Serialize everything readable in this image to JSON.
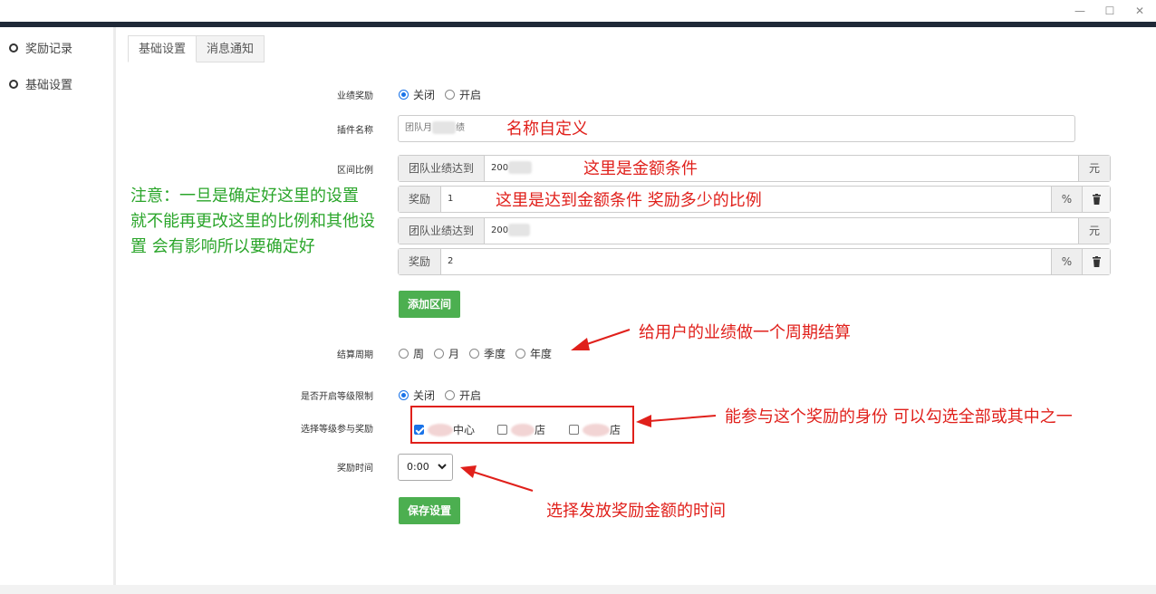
{
  "window": {
    "controls": [
      "—",
      "☐",
      "✕"
    ]
  },
  "sidebar": {
    "items": [
      {
        "label": "奖励记录"
      },
      {
        "label": "基础设置"
      }
    ]
  },
  "tabs": [
    {
      "label": "基础设置",
      "active": true
    },
    {
      "label": "消息通知",
      "active": false
    }
  ],
  "form": {
    "performance_reward": {
      "label": "业绩奖励",
      "options": [
        "关闭",
        "开启"
      ],
      "selected": "关闭"
    },
    "plugin_name": {
      "label": "插件名称",
      "value_prefix": "团队月",
      "value_suffix": "绩"
    },
    "range_ratio": {
      "label": "区间比例",
      "rows": [
        {
          "addon": "团队业绩达到",
          "value": "200",
          "unit": "元"
        },
        {
          "addon": "奖励",
          "value": "1",
          "unit": "%"
        },
        {
          "addon": "团队业绩达到",
          "value": "200",
          "unit": "元"
        },
        {
          "addon": "奖励",
          "value": "2",
          "unit": "%"
        }
      ],
      "trash_icon": "trash-icon"
    },
    "add_range_button": "添加区间",
    "settlement_period": {
      "label": "结算周期",
      "options": [
        "周",
        "月",
        "季度",
        "年度"
      ]
    },
    "level_limit": {
      "label": "是否开启等级限制",
      "options": [
        "关闭",
        "开启"
      ],
      "selected": "关闭"
    },
    "level_select": {
      "label": "选择等级参与奖励",
      "options": [
        {
          "suffix": "中心",
          "checked": true
        },
        {
          "suffix": "店",
          "checked": false
        },
        {
          "suffix": "店",
          "checked": false
        }
      ]
    },
    "reward_time": {
      "label": "奖励时间",
      "value": "0:00"
    },
    "save_button": "保存设置"
  },
  "annotations": {
    "name_custom": "名称自定义",
    "amount_condition": "这里是金额条件",
    "ratio_condition": "这里是达到金额条件 奖励多少的比例",
    "period_note": "给用户的业绩做一个周期结算",
    "identity_note": "能参与这个奖励的身份 可以勾选全部或其中之一",
    "time_note": "选择发放奖励金额的时间",
    "warning": "注意：一旦是确定好这里的设置 就不能再更改这里的比例和其他设置 会有影响所以要确定好"
  },
  "colors": {
    "annotation_red": "#e0201b",
    "annotation_green": "#2aa52a",
    "button_green": "#4caf50",
    "radio_blue": "#1a73e8"
  }
}
